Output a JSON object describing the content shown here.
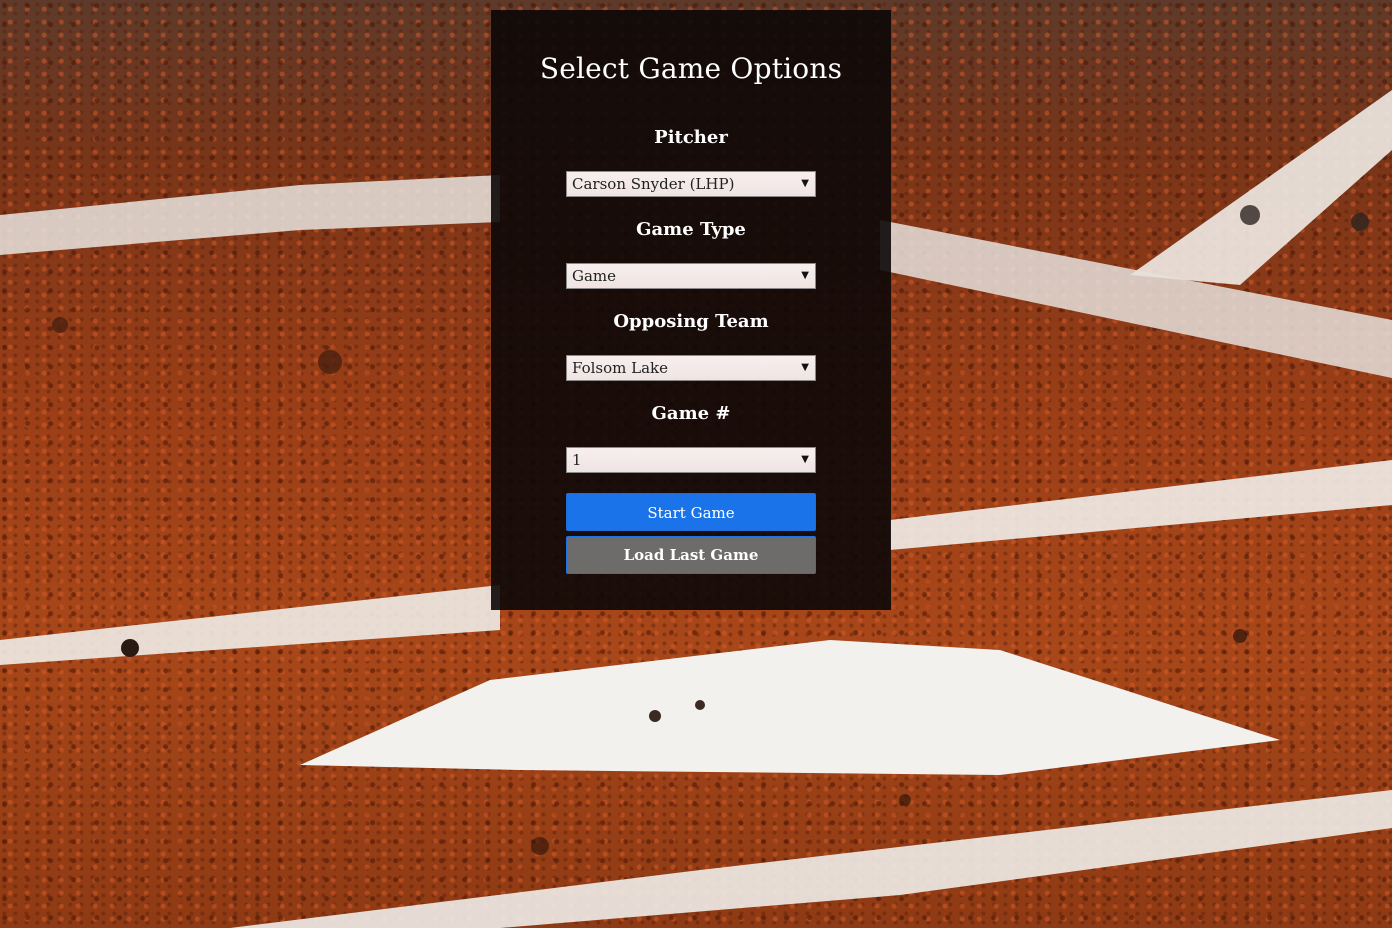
{
  "page": {
    "title": "Select Game Options"
  },
  "form": {
    "pitcher": {
      "label": "Pitcher",
      "value": "Carson Snyder (LHP)"
    },
    "game_type": {
      "label": "Game Type",
      "value": "Game"
    },
    "opposing_team": {
      "label": "Opposing Team",
      "value": "Folsom Lake"
    },
    "game_number": {
      "label": "Game #",
      "value": "1"
    }
  },
  "buttons": {
    "start": "Start Game",
    "load_last": "Load Last Game"
  },
  "colors": {
    "panel_bg": "#0c0808",
    "start_button": "#1a73e8",
    "load_button": "#6e6b6b",
    "select_bg": "#f3e9e8",
    "dirt": "#9c3f17",
    "chalk": "#f4f2ef"
  },
  "icons": {
    "select_arrow": "caret-down-icon"
  }
}
